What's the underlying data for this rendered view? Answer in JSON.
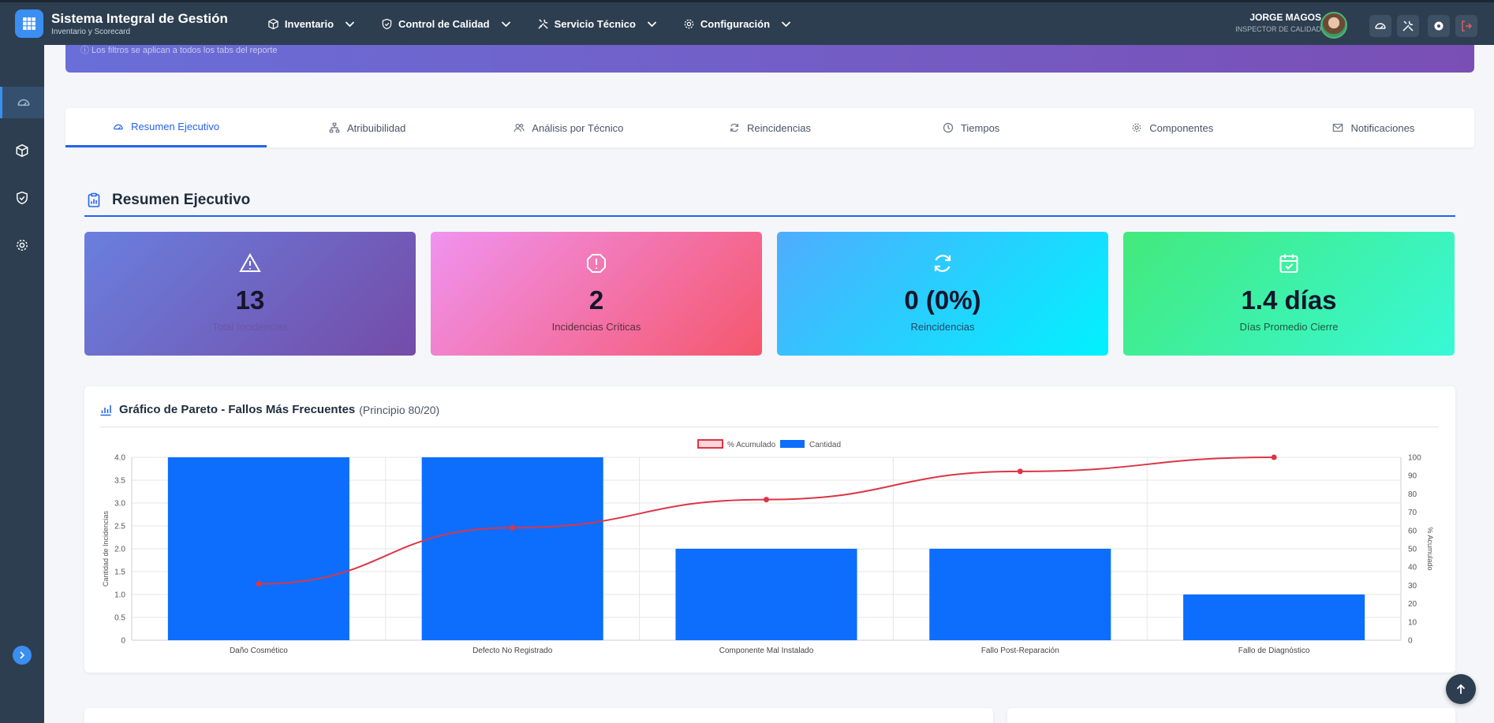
{
  "app": {
    "title": "Sistema Integral de Gestión",
    "subtitle": "Inventario y Scorecard"
  },
  "nav": [
    {
      "label": "Inventario",
      "icon": "box-icon"
    },
    {
      "label": "Control de Calidad",
      "icon": "shield-icon"
    },
    {
      "label": "Servicio Técnico",
      "icon": "tools-icon"
    },
    {
      "label": "Configuración",
      "icon": "gear-icon"
    }
  ],
  "user": {
    "name": "JORGE MAGOS",
    "role": "INSPECTOR DE CALIDAD"
  },
  "toolbar_icons": [
    "dashboard-icon",
    "tools-icon",
    "gear-icon",
    "logout-icon"
  ],
  "sidebar": [
    "dashboard-icon",
    "box-icon",
    "shield-icon",
    "gear-icon"
  ],
  "banner": {
    "note": "ⓘ Los filtros se aplican a todos los tabs del reporte"
  },
  "tabs": [
    {
      "label": "Resumen Ejecutivo",
      "icon": "dashboard-icon",
      "active": true
    },
    {
      "label": "Atribuibilidad",
      "icon": "sitemap-icon",
      "active": false
    },
    {
      "label": "Análisis por Técnico",
      "icon": "users-icon",
      "active": false
    },
    {
      "label": "Reincidencias",
      "icon": "refresh-icon",
      "active": false
    },
    {
      "label": "Tiempos",
      "icon": "clock-icon",
      "active": false
    },
    {
      "label": "Componentes",
      "icon": "gear-icon",
      "active": false
    },
    {
      "label": "Notificaciones",
      "icon": "envelope-icon",
      "active": false
    }
  ],
  "section": {
    "title": "Resumen Ejecutivo"
  },
  "kpis": [
    {
      "value": "13",
      "label": "Total Incidencias",
      "icon": "warning-icon"
    },
    {
      "value": "2",
      "label": "Incidencias Críticas",
      "icon": "alert-octagon-icon"
    },
    {
      "value": "0 (0%)",
      "label": "Reincidencias",
      "icon": "refresh-icon"
    },
    {
      "value": "1.4 días",
      "label": "Días Promedio Cierre",
      "icon": "calendar-check-icon"
    }
  ],
  "colors": {
    "primary": "#2563eb",
    "bar": "#0d6efd",
    "line": "#dc3545",
    "topbar": "#2d3e50"
  },
  "chart_card": {
    "title": "Gráfico de Pareto - Fallos Más Frecuentes",
    "subtitle": "(Principio 80/20)"
  },
  "chart_data": {
    "type": "bar",
    "categories": [
      "Daño Cosmético",
      "Defecto No Registrado",
      "Componente Mal Instalado",
      "Fallo Post-Reparación",
      "Fallo de Diagnóstico"
    ],
    "series": [
      {
        "name": "Cantidad",
        "type": "bar",
        "axis": "left",
        "values": [
          4,
          4,
          2,
          2,
          1
        ]
      },
      {
        "name": "% Acumulado",
        "type": "line",
        "axis": "right",
        "values": [
          30.8,
          61.5,
          76.9,
          92.3,
          100
        ]
      }
    ],
    "ylabel": "Cantidad de Incidencias",
    "y2label": "% Acumulado",
    "ylim": [
      0,
      4
    ],
    "y2lim": [
      0,
      100
    ],
    "yticks": [
      "0",
      "0.5",
      "1.0",
      "1.5",
      "2.0",
      "2.5",
      "3.0",
      "3.5",
      "4.0"
    ],
    "y2ticks": [
      "0",
      "10",
      "20",
      "30",
      "40",
      "50",
      "60",
      "70",
      "80",
      "90",
      "100"
    ],
    "legend_position": "top",
    "grid": true
  }
}
